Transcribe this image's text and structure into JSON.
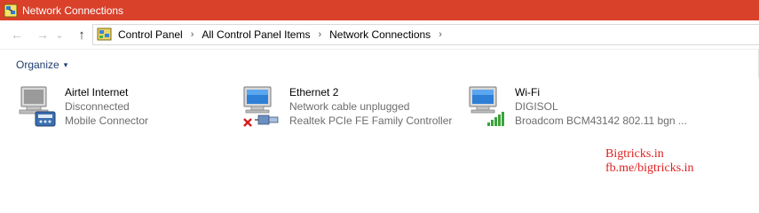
{
  "window": {
    "title": "Network Connections"
  },
  "nav": {
    "back_glyph": "←",
    "forward_glyph": "→",
    "recent_glyph": "⌄",
    "up_glyph": "↑"
  },
  "address": {
    "crumbs": [
      "Control Panel",
      "All Control Panel Items",
      "Network Connections"
    ],
    "separator": "›"
  },
  "toolbar": {
    "organize_label": "Organize",
    "organize_caret": "▾"
  },
  "connections": [
    {
      "name": "Airtel Internet",
      "status": "Disconnected",
      "device": "Mobile Connector",
      "icon": "modem-connection-icon"
    },
    {
      "name": "Ethernet 2",
      "status": "Network cable unplugged",
      "device": "Realtek PCIe FE Family Controller",
      "icon": "ethernet-connection-icon"
    },
    {
      "name": "Wi-Fi",
      "status": "DIGISOL",
      "device": "Broadcom BCM43142 802.11 bgn ...",
      "icon": "wifi-connection-icon"
    }
  ],
  "watermark": {
    "line1": "Bigtricks.in",
    "line2": "fb.me/bigtricks.in"
  },
  "colors": {
    "titlebar": "#d9412b",
    "accent_text": "#1e3d6f",
    "watermark": "#e02020"
  }
}
